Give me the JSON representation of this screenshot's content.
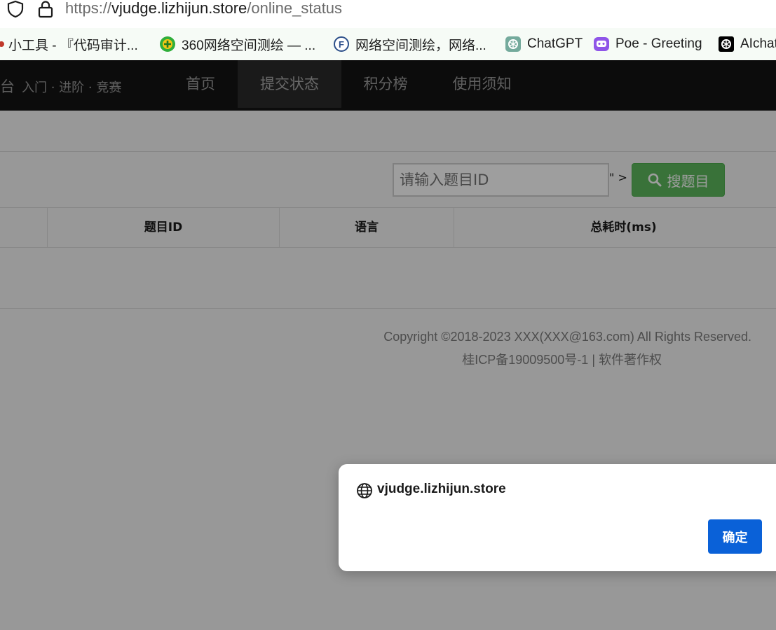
{
  "browser": {
    "url_scheme": "https://",
    "url_host": "vjudge.lizhijun.store",
    "url_path": "/online_status",
    "bookmarks": [
      {
        "label": "小工具 - 『代码审计...",
        "icon": "tool-icon"
      },
      {
        "label": "360网络空间测绘 — ...",
        "icon": "360-icon"
      },
      {
        "label": "网络空间测绘，网络...",
        "icon": "fofa-icon"
      },
      {
        "label": "ChatGPT",
        "icon": "chatgpt-icon"
      },
      {
        "label": "Poe - Greeting",
        "icon": "poe-icon"
      },
      {
        "label": "AIchat",
        "icon": "aichat-icon"
      }
    ]
  },
  "navbar": {
    "brand_tail": "台",
    "tagline": "入门 · 进阶 · 竞赛",
    "items": [
      {
        "label": "首页"
      },
      {
        "label": "提交状态",
        "active": true
      },
      {
        "label": "积分榜"
      },
      {
        "label": "使用须知"
      }
    ]
  },
  "search": {
    "placeholder": "请输入题目ID",
    "quote_gt": "\" >",
    "button_label": "搜题目"
  },
  "table": {
    "headers": [
      "题目ID",
      "语言",
      "总耗时(ms)"
    ]
  },
  "footer": {
    "line1": "Copyright ©2018-2023 XXX(XXX@163.com) All Rights Reserved.",
    "line2": "桂ICP备19009500号-1 | 软件著作权"
  },
  "dialog": {
    "origin": "vjudge.lizhijun.store",
    "ok_label": "确定"
  },
  "colors": {
    "nav_bg": "#141414",
    "search_button": "#5cb85c",
    "dialog_button": "#0a61d8"
  }
}
